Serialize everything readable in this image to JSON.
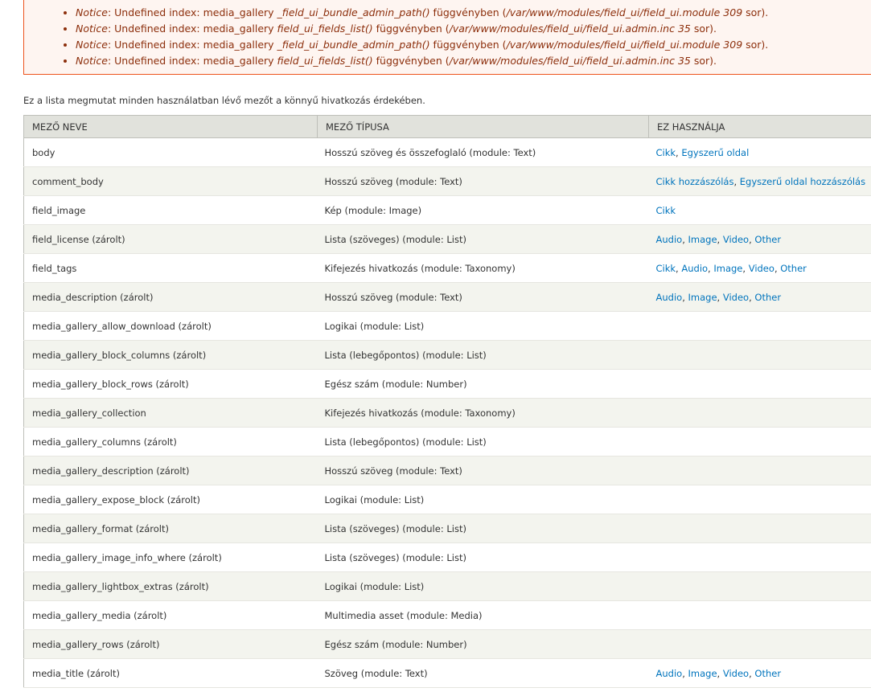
{
  "messages": [
    {
      "label": "Notice",
      "text1": ": Undefined index: media_gallery ",
      "func": "_field_ui_bundle_admin_path()",
      "text2": " függvényben (",
      "file": "/var/www/modules/field_ui/field_ui.module",
      "line": "309",
      "text3": " sor)."
    },
    {
      "label": "Notice",
      "text1": ": Undefined index: media_gallery ",
      "func": "field_ui_fields_list()",
      "text2": " függvényben (",
      "file": "/var/www/modules/field_ui/field_ui.admin.inc",
      "line": "35",
      "text3": " sor)."
    },
    {
      "label": "Notice",
      "text1": ": Undefined index: media_gallery ",
      "func": "_field_ui_bundle_admin_path()",
      "text2": " függvényben (",
      "file": "/var/www/modules/field_ui/field_ui.module",
      "line": "309",
      "text3": " sor)."
    },
    {
      "label": "Notice",
      "text1": ": Undefined index: media_gallery ",
      "func": "field_ui_fields_list()",
      "text2": " függvényben (",
      "file": "/var/www/modules/field_ui/field_ui.admin.inc",
      "line": "35",
      "text3": " sor)."
    }
  ],
  "intro": "Ez a lista megmutat minden használatban lévő mezőt a könnyű hivatkozás érdekében.",
  "table": {
    "headers": [
      "Mező neve",
      "Mező típusa",
      "Ez használja"
    ],
    "rows": [
      {
        "name": "body",
        "type": "Hosszú szöveg és összefoglaló (module: Text)",
        "used": [
          "Cikk",
          "Egyszerű oldal"
        ]
      },
      {
        "name": "comment_body",
        "type": "Hosszú szöveg (module: Text)",
        "used": [
          "Cikk hozzászólás",
          "Egyszerű oldal hozzászólás"
        ]
      },
      {
        "name": "field_image",
        "type": "Kép (module: Image)",
        "used": [
          "Cikk"
        ]
      },
      {
        "name": "field_license (zárolt)",
        "type": "Lista (szöveges) (module: List)",
        "used": [
          "Audio",
          "Image",
          "Video",
          "Other"
        ]
      },
      {
        "name": "field_tags",
        "type": "Kifejezés hivatkozás (module: Taxonomy)",
        "used": [
          "Cikk",
          "Audio",
          "Image",
          "Video",
          "Other"
        ]
      },
      {
        "name": "media_description (zárolt)",
        "type": "Hosszú szöveg (module: Text)",
        "used": [
          "Audio",
          "Image",
          "Video",
          "Other"
        ]
      },
      {
        "name": "media_gallery_allow_download (zárolt)",
        "type": "Logikai (module: List)",
        "used": []
      },
      {
        "name": "media_gallery_block_columns (zárolt)",
        "type": "Lista (lebegőpontos) (module: List)",
        "used": []
      },
      {
        "name": "media_gallery_block_rows (zárolt)",
        "type": "Egész szám (module: Number)",
        "used": []
      },
      {
        "name": "media_gallery_collection",
        "type": "Kifejezés hivatkozás (module: Taxonomy)",
        "used": []
      },
      {
        "name": "media_gallery_columns (zárolt)",
        "type": "Lista (lebegőpontos) (module: List)",
        "used": []
      },
      {
        "name": "media_gallery_description (zárolt)",
        "type": "Hosszú szöveg (module: Text)",
        "used": []
      },
      {
        "name": "media_gallery_expose_block (zárolt)",
        "type": "Logikai (module: List)",
        "used": []
      },
      {
        "name": "media_gallery_format (zárolt)",
        "type": "Lista (szöveges) (module: List)",
        "used": []
      },
      {
        "name": "media_gallery_image_info_where (zárolt)",
        "type": "Lista (szöveges) (module: List)",
        "used": []
      },
      {
        "name": "media_gallery_lightbox_extras (zárolt)",
        "type": "Logikai (module: List)",
        "used": []
      },
      {
        "name": "media_gallery_media (zárolt)",
        "type": "Multimedia asset (module: Media)",
        "used": []
      },
      {
        "name": "media_gallery_rows (zárolt)",
        "type": "Egész szám (module: Number)",
        "used": []
      },
      {
        "name": "media_title (zárolt)",
        "type": "Szöveg (module: Text)",
        "used": [
          "Audio",
          "Image",
          "Video",
          "Other"
        ]
      }
    ]
  },
  "colors": {
    "link": "#0074bd",
    "error_text": "#8c2e0b",
    "error_border": "#ed541d",
    "error_bg": "#fef5f1",
    "header_bg": "#e1e2dc",
    "row_even_bg": "#f3f4ee"
  }
}
